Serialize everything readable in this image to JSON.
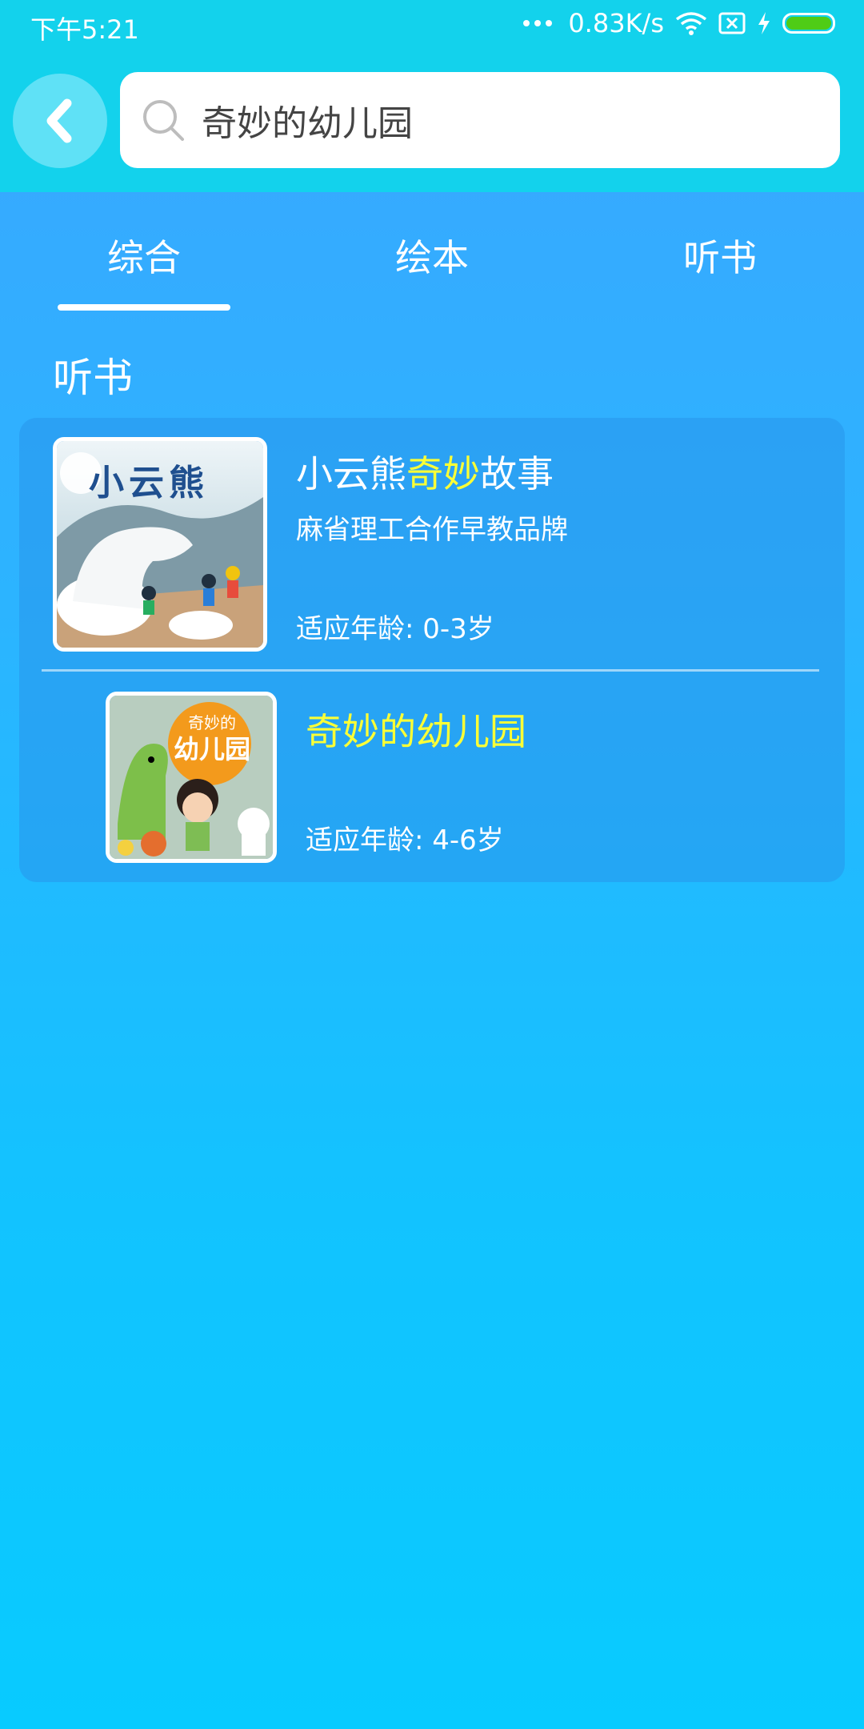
{
  "status_bar": {
    "time": "下午5:21",
    "net_speed": "0.83K/s",
    "battery_color": "#4fcc16"
  },
  "header": {
    "back_icon": "chevron-left-icon",
    "search_icon": "search-icon",
    "search_query": "奇妙的幼儿园"
  },
  "tabs": [
    {
      "label": "综合",
      "active": true
    },
    {
      "label": "绘本",
      "active": false
    },
    {
      "label": "听书",
      "active": false
    }
  ],
  "section": {
    "title": "听书"
  },
  "results": [
    {
      "title_prefix": "小云熊",
      "title_highlight": "奇妙",
      "title_suffix": "故事",
      "subtitle": "麻省理工合作早教品牌",
      "age": "适应年龄: 0-3岁",
      "cover_text": "小云熊"
    },
    {
      "title_prefix": "",
      "title_highlight": "奇妙的幼儿园",
      "title_suffix": "",
      "subtitle": "",
      "age": "适应年龄: 4-6岁",
      "cover_text_top": "奇妙的",
      "cover_text_main": "幼儿园"
    }
  ],
  "colors": {
    "topbar": "#13d2ec",
    "highlight": "#fbff36",
    "background_top": "#3aa6ff",
    "background_bottom": "#08cbff"
  }
}
